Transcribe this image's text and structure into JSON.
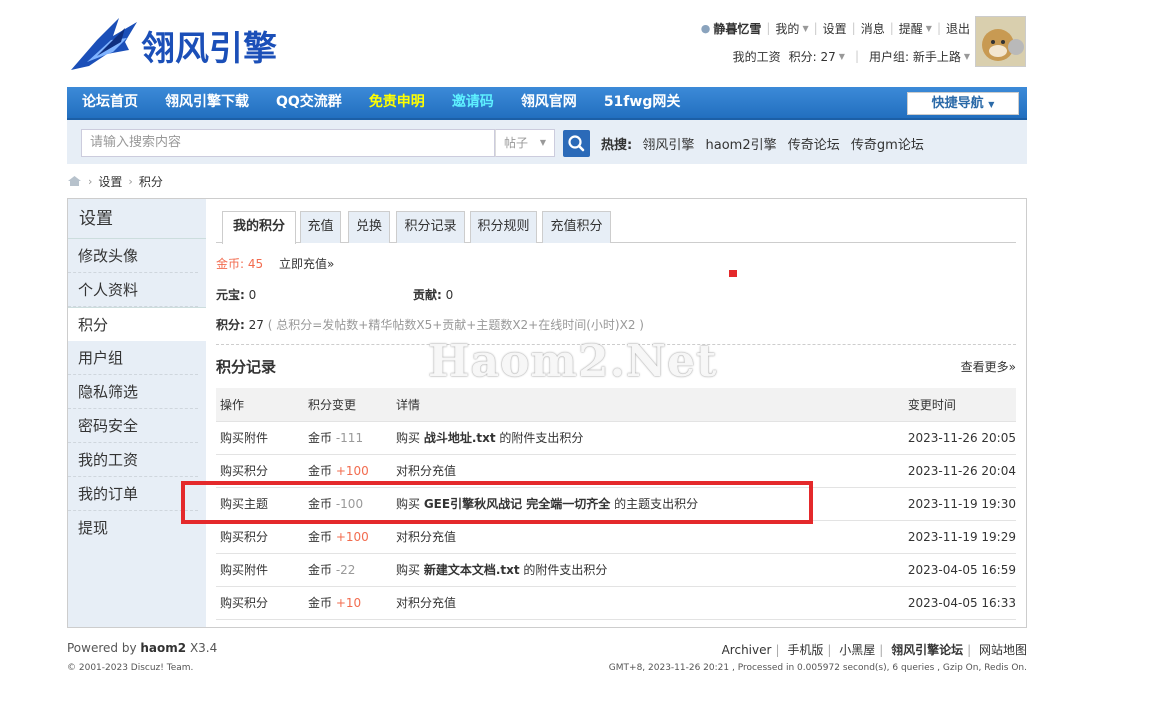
{
  "logo": {
    "text": "翎风引擎"
  },
  "userbar": {
    "username": "静暮忆雪",
    "links": [
      "我的",
      "设置",
      "消息",
      "提醒",
      "退出"
    ],
    "salary": "我的工资",
    "credits_label": "积分: 27",
    "usergroup_label": "用户组: 新手上路"
  },
  "nav": {
    "items": [
      {
        "label": "论坛首页",
        "color": "#ffffff"
      },
      {
        "label": "翎风引擎下载",
        "color": "#ffffff"
      },
      {
        "label": "QQ交流群",
        "color": "#ffffff"
      },
      {
        "label": "免责申明",
        "color": "#ffff00"
      },
      {
        "label": "邀请码",
        "color": "#5ef0ff"
      },
      {
        "label": "翎风官网",
        "color": "#ffffff"
      },
      {
        "label": "51fwg网关",
        "color": "#ffffff"
      }
    ],
    "quick_nav": "快捷导航"
  },
  "search": {
    "placeholder": "请输入搜索内容",
    "type": "帖子",
    "hot_label": "热搜:",
    "hot_keywords": [
      "翎风引擎",
      "haom2引擎",
      "传奇论坛",
      "传奇gm论坛"
    ]
  },
  "breadcrumb": [
    "设置",
    "积分"
  ],
  "sidebar": {
    "title": "设置",
    "items": [
      "修改头像",
      "个人资料",
      "积分",
      "用户组",
      "隐私筛选",
      "密码安全",
      "我的工资",
      "我的订单",
      "提现"
    ],
    "active": "积分"
  },
  "tabs": [
    "我的积分",
    "充值",
    "兑换",
    "积分记录",
    "积分规则",
    "充值积分"
  ],
  "credits": {
    "gold_label": "金币:",
    "gold_value": "45",
    "recharge_link": "立即充值»",
    "yuanbao_label": "元宝:",
    "yuanbao_value": "0",
    "contrib_label": "贡献:",
    "contrib_value": "0",
    "total_label": "积分:",
    "total_value": "27",
    "formula": "( 总积分=发帖数+精华帖数X5+贡献+主题数X2+在线时间(小时)X2 )"
  },
  "log": {
    "title": "积分记录",
    "more": "查看更多»",
    "headers": [
      "操作",
      "积分变更",
      "详情",
      "变更时间"
    ],
    "rows": [
      {
        "op": "购买附件",
        "currency": "金币",
        "change": "-111",
        "pre": "购买 ",
        "bold": "战斗地址.txt",
        "post": " 的附件支出积分",
        "time": "2023-11-26 20:05"
      },
      {
        "op": "购买积分",
        "currency": "金币",
        "change": "+100",
        "pre": "对积分充值",
        "bold": "",
        "post": "",
        "time": "2023-11-26 20:04"
      },
      {
        "op": "购买主题",
        "currency": "金币",
        "change": "-100",
        "pre": "购买 ",
        "bold": "GEE引擎秋风战记 完全端一切齐全",
        "post": " 的主题支出积分",
        "time": "2023-11-19 19:30"
      },
      {
        "op": "购买积分",
        "currency": "金币",
        "change": "+100",
        "pre": "对积分充值",
        "bold": "",
        "post": "",
        "time": "2023-11-19 19:29"
      },
      {
        "op": "购买附件",
        "currency": "金币",
        "change": "-22",
        "pre": "购买 ",
        "bold": "新建文本文档.txt",
        "post": " 的附件支出积分",
        "time": "2023-04-05 16:59"
      },
      {
        "op": "购买积分",
        "currency": "金币",
        "change": "+10",
        "pre": "对积分充值",
        "bold": "",
        "post": "",
        "time": "2023-04-05 16:33"
      }
    ]
  },
  "watermark": "Haom2.Net",
  "footer": {
    "powered_prefix": "Powered by ",
    "powered_name": "haom2",
    "powered_version": " X3.4",
    "copyright": "© 2001-2023 Discuz! Team.",
    "links": [
      "Archiver",
      "手机版",
      "小黑屋",
      "翎风引擎论坛",
      "网站地图"
    ],
    "gmt": "GMT+8, 2023-11-26 20:21 , Processed in 0.005972 second(s), 6 queries , Gzip On, Redis On."
  },
  "colors": {
    "nav": "#2b7acd",
    "accent_red": "#e4292b",
    "gold": "#f26c4f",
    "side_bg": "#e7eef6"
  }
}
